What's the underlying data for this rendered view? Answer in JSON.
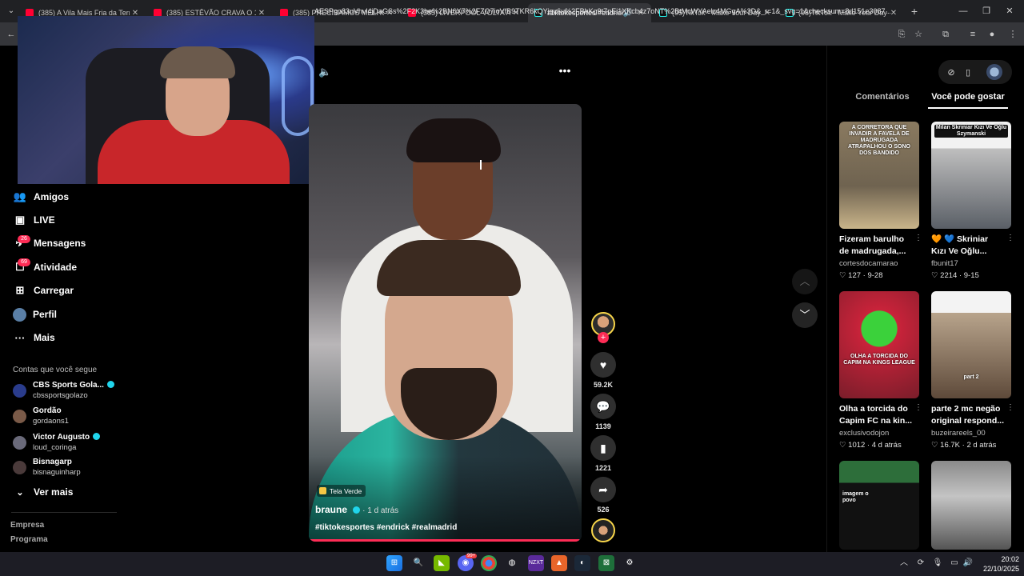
{
  "browser": {
    "tabs": [
      {
        "title": "(385) A Vila Mais Fria da Terra?",
        "kind": "youtube"
      },
      {
        "title": "(385) ESTÊVÃO CRAVA O 1º NO",
        "kind": "youtube"
      },
      {
        "title": "(385) PRECISAMOS MELHORAR",
        "kind": "youtube"
      },
      {
        "title": "(385) LIVERPOOL VOLTA A VEN",
        "kind": "youtube"
      },
      {
        "title": "#tiktokesportes #endrick #",
        "kind": "tiktok",
        "active": true
      },
      {
        "title": "(95)TikTok - Make Your Day",
        "kind": "tiktok"
      },
      {
        "title": "(95)TikTok - Make Your Day",
        "kind": "tiktok"
      }
    ],
    "url": "AESPgo83uVhvl4jDaGSs%2F2K3he%2BN6X7%2FZO7ioVfB9TKR6kQYjgv6u%2FBhKg9t7pEi1XKcb4z7oNT%2BtMcWYAelz4MGgA%3D&_r=1&_svg=1&checksum=8d151e3087..."
  },
  "sidebar": {
    "nav": [
      {
        "label": "Amigos",
        "icon": "friends-icon"
      },
      {
        "label": "LIVE",
        "icon": "live-icon"
      },
      {
        "label": "Mensagens",
        "icon": "messages-icon",
        "badge": "26"
      },
      {
        "label": "Atividade",
        "icon": "activity-icon",
        "badge": "69"
      },
      {
        "label": "Carregar",
        "icon": "upload-icon"
      },
      {
        "label": "Perfil",
        "icon": "profile-icon"
      },
      {
        "label": "Mais",
        "icon": "more-icon"
      }
    ],
    "following_heading": "Contas que você segue",
    "accounts": [
      {
        "name": "CBS Sports Gola...",
        "handle": "cbssportsgolazo",
        "verified": true
      },
      {
        "name": "Gordão",
        "handle": "gordaons1",
        "verified": false
      },
      {
        "name": "Victor Augusto",
        "handle": "loud_coringa",
        "verified": true
      },
      {
        "name": "Bisnagarp",
        "handle": "bisnaguinharp",
        "verified": false
      }
    ],
    "see_more": "Ver mais",
    "footer": [
      "Empresa",
      "Programa"
    ]
  },
  "video": {
    "tag_chip": "Tela Verde",
    "author": "braune",
    "time": "· 1 d atrás",
    "hashtags": "#tiktokesportes #endrick #realmadrid",
    "progress": 0.99
  },
  "actions": {
    "likes": "59.2K",
    "comments": "1139",
    "saves": "1221",
    "shares": "526"
  },
  "right_panel": {
    "tabs": [
      "Comentários",
      "Você pode gostar"
    ],
    "active_tab": 1,
    "cards": [
      {
        "thumb_text": "A CORRETORA QUE INVADIR A FAVELA DE MADRUGADA ATRAPALHOU O SONO DOS BANDIDO",
        "desc": "Fizeram barulho de madrugada,...",
        "user": "cortesdocamarao",
        "likes": "127",
        "date": "9-28"
      },
      {
        "thumb_text": "Milan Skriniar Kızı Ve Oğlu Szymanski",
        "desc": "🧡 💙 Skriniar Kızı Ve Oğlu...",
        "user": "fbunit17",
        "likes": "2214",
        "date": "9-15"
      },
      {
        "thumb_text": "OLHA A TORCIDA DO CAPIM NA KINGS LEAGUE",
        "desc": "Olha a torcida do Capim FC na kin...",
        "user": "exclusivodojon",
        "likes": "1012",
        "date": "4 d atrás"
      },
      {
        "thumb_text": "part 2",
        "desc": "parte 2 mc negão original respond...",
        "user": "buzeirareels_00",
        "likes": "16.7K",
        "date": "2 d atrás"
      },
      {
        "thumb_text": "imagem o povo",
        "desc": "",
        "user": "",
        "likes": "",
        "date": ""
      },
      {
        "thumb_text": "",
        "desc": "",
        "user": "",
        "likes": "",
        "date": ""
      }
    ]
  },
  "taskbar": {
    "time": "20:02",
    "date": "22/10/2025",
    "discord_badge": "99+"
  }
}
